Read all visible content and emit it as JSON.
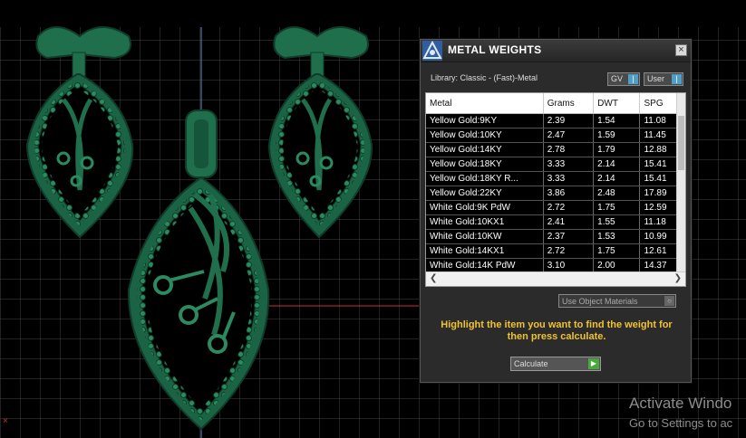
{
  "panel": {
    "title": "METAL WEIGHTS",
    "close_label": "×",
    "library_label": "Library: Classic - (Fast)-Metal",
    "gv_toggle": "GV",
    "user_toggle": "User",
    "table": {
      "columns": [
        "Metal",
        "Grams",
        "DWT",
        "SPG"
      ],
      "rows": [
        [
          "Yellow Gold:9KY",
          "2.39",
          "1.54",
          "11.08"
        ],
        [
          "Yellow Gold:10KY",
          "2.47",
          "1.59",
          "11.45"
        ],
        [
          "Yellow Gold:14KY",
          "2.78",
          "1.79",
          "12.88"
        ],
        [
          "Yellow Gold:18KY",
          "3.33",
          "2.14",
          "15.41"
        ],
        [
          "Yellow Gold:18KY R...",
          "3.33",
          "2.14",
          "15.41"
        ],
        [
          "Yellow Gold:22KY",
          "3.86",
          "2.48",
          "17.89"
        ],
        [
          "White Gold:9K PdW",
          "2.72",
          "1.75",
          "12.59"
        ],
        [
          "White Gold:10KX1",
          "2.41",
          "1.55",
          "11.18"
        ],
        [
          "White Gold:10KW",
          "2.37",
          "1.53",
          "10.99"
        ],
        [
          "White Gold:14KX1",
          "2.72",
          "1.75",
          "12.61"
        ],
        [
          "White Gold:14K PdW",
          "3.10",
          "2.00",
          "14.37"
        ]
      ]
    },
    "object_materials_label": "Use Object Materials",
    "hint": "Highlight the item you want to find the weight for then press calculate.",
    "calculate_label": "Calculate"
  },
  "watermark": {
    "line1": "Activate Windo",
    "line2": "Go to Settings to ac"
  },
  "colors": {
    "model_green": "#1f6e4c",
    "hint_yellow": "#f0c330",
    "accent_blue": "#4f9ec9",
    "calculate_green": "#47a83c"
  },
  "icons": [
    "app-logo-icon",
    "close-icon",
    "toggle-indicator-icon",
    "scroll-left-icon",
    "scroll-right-icon",
    "dropdown-icon",
    "play-icon"
  ]
}
